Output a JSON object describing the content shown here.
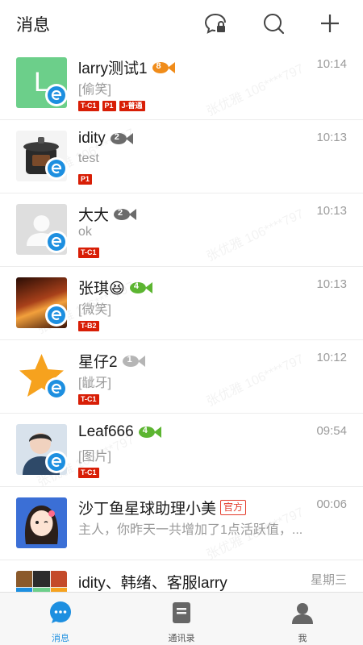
{
  "header": {
    "title": "消息",
    "icons": [
      "chat-lock-icon",
      "search-icon",
      "plus-icon"
    ]
  },
  "watermark": {
    "name": "张优雅",
    "number": "106****797"
  },
  "conversations": [
    {
      "name": "larry测试1",
      "level": "8",
      "time": "10:14",
      "message": "[偷笑]",
      "tags": [
        "T-C1",
        "P1",
        "J-普通"
      ],
      "avatar_letter": "L"
    },
    {
      "name": "idity",
      "level": "2",
      "time": "10:13",
      "message": "test",
      "tags": [
        "P1"
      ]
    },
    {
      "name": "大大",
      "level": "2",
      "time": "10:13",
      "message": "ok",
      "tags": [
        "T-C1"
      ]
    },
    {
      "name": "张琪😆",
      "level": "4",
      "time": "10:13",
      "message": "[微笑]",
      "tags": [
        "T-B2"
      ]
    },
    {
      "name": "星仔2",
      "level": "1",
      "time": "10:12",
      "message": "[龇牙]",
      "tags": [
        "T-C1"
      ]
    },
    {
      "name": "Leaf666",
      "level": "4",
      "time": "09:54",
      "message": "[图片]",
      "tags": [
        "T-C1"
      ]
    },
    {
      "name": "沙丁鱼星球助理小美",
      "badge": "官方",
      "time": "00:06",
      "message": "主人，你昨天一共增加了1点活跃值，..."
    },
    {
      "name": "idity、韩绪、客服larry",
      "time": "星期三"
    }
  ],
  "tabs": [
    {
      "label": "消息",
      "icon": "message-bubble-icon",
      "active": true
    },
    {
      "label": "通讯录",
      "icon": "contacts-book-icon",
      "active": false
    },
    {
      "label": "我",
      "icon": "person-icon",
      "active": false
    }
  ],
  "colors": {
    "accent": "#1d8fe0",
    "tag_red": "#d81e06",
    "fish_orange": "#f08c1a",
    "fish_gray": "#6b6b6b",
    "fish_green": "#5cb531",
    "fish_light": "#b5b5b5"
  }
}
